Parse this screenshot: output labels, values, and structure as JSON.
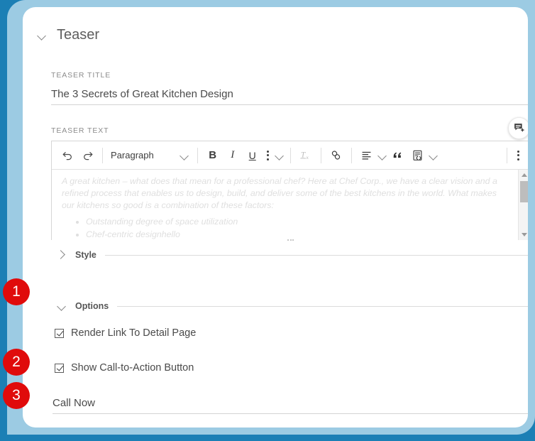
{
  "theme": {
    "frame_outer": "#1b7fb5",
    "frame_inner": "#9ccbe3",
    "card_bg": "#ffffff",
    "badge_red": "#e00b0b",
    "label_gray": "#8c8c8c",
    "text_gray": "#4a4a4a",
    "placeholder_gray": "#dfdfdf"
  },
  "panel": {
    "section_title": "Teaser",
    "collapse_icon": "chevron-down-icon"
  },
  "fields": {
    "teaser_title": {
      "label": "TEASER TITLE",
      "value": "The 3 Secrets of Great Kitchen Design"
    },
    "teaser_text": {
      "label": "TEASER TEXT"
    }
  },
  "editor": {
    "toolbar": {
      "undo": "undo-icon",
      "redo": "redo-icon",
      "style_select": "Paragraph",
      "style_select_caret": "chevron-down-icon",
      "bold": "B",
      "italic": "I",
      "underline": "U",
      "more_text": "kebab-icon",
      "more_text_caret": "chevron-down-icon",
      "remove_format": "remove-format-icon",
      "link": "link-icon",
      "align": "align-left-icon",
      "align_caret": "chevron-down-icon",
      "blockquote": "blockquote-icon",
      "code_block": "code-block-icon",
      "code_block_caret": "chevron-down-icon",
      "overflow": "kebab-icon"
    },
    "content": {
      "paragraph": "A great kitchen – what does that mean for a professional chef? Here at Chef Corp., we have a clear vision and a refined process that enables us to design, build, and deliver some of the best kitchens in the world. What makes our kitchens so good is a combination of these factors:",
      "bullets": [
        "Outstanding degree of space utilization",
        "Chef-centric designhello"
      ]
    },
    "scrollbar": {
      "up_arrow": "triangle-up-icon",
      "down_arrow": "triangle-down-icon"
    },
    "resize_grip": "resize-grip-icon"
  },
  "comment_button": {
    "icon": "add-comment-icon"
  },
  "sections": [
    {
      "label": "Style",
      "expanded": false,
      "icon": "chevron-right-icon"
    },
    {
      "label": "Options",
      "expanded": true,
      "icon": "chevron-down-icon"
    }
  ],
  "options": {
    "checkboxes": [
      {
        "label": "Render Link To Detail Page",
        "checked": true
      },
      {
        "label": "Show Call-to-Action Button",
        "checked": true
      }
    ],
    "cta_label_field": {
      "value": "Call Now"
    }
  },
  "step_badges": [
    {
      "number": "1"
    },
    {
      "number": "2"
    },
    {
      "number": "3"
    }
  ]
}
